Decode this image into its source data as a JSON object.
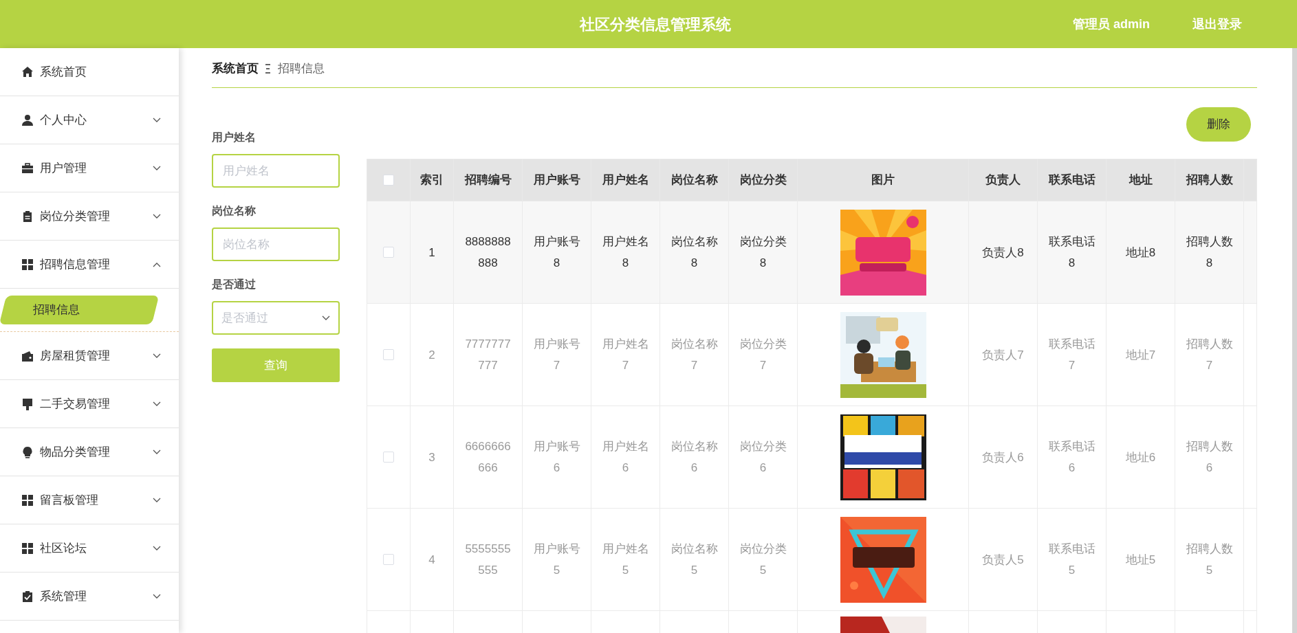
{
  "header": {
    "title": "社区分类信息管理系统",
    "user": "管理员 admin",
    "logout": "退出登录"
  },
  "sidebar": {
    "items": [
      {
        "label": "系统首页",
        "kind": "link"
      },
      {
        "label": "个人中心",
        "kind": "menu",
        "expanded": false
      },
      {
        "label": "用户管理",
        "kind": "menu",
        "expanded": false
      },
      {
        "label": "岗位分类管理",
        "kind": "menu",
        "expanded": false
      },
      {
        "label": "招聘信息管理",
        "kind": "menu",
        "expanded": true,
        "children": [
          {
            "label": "招聘信息",
            "selected": true
          }
        ]
      },
      {
        "label": "房屋租赁管理",
        "kind": "menu",
        "expanded": false
      },
      {
        "label": "二手交易管理",
        "kind": "menu",
        "expanded": false
      },
      {
        "label": "物品分类管理",
        "kind": "menu",
        "expanded": false
      },
      {
        "label": "留言板管理",
        "kind": "menu",
        "expanded": false
      },
      {
        "label": "社区论坛",
        "kind": "menu",
        "expanded": false
      },
      {
        "label": "系统管理",
        "kind": "menu",
        "expanded": false
      }
    ]
  },
  "breadcrumb": {
    "home": "系统首页",
    "current": "招聘信息"
  },
  "filters": [
    {
      "label": "用户姓名",
      "kind": "text",
      "placeholder": "用户姓名"
    },
    {
      "label": "岗位名称",
      "kind": "text",
      "placeholder": "岗位名称"
    },
    {
      "label": "是否通过",
      "kind": "select",
      "placeholder": "是否通过"
    }
  ],
  "search_button": "查询",
  "delete_button": "删除",
  "table": {
    "select_all": {
      "checked": false
    },
    "columns": [
      {
        "label": "索引",
        "kind": "text"
      },
      {
        "label": "招聘编号",
        "kind": "text"
      },
      {
        "label": "用户账号",
        "kind": "text"
      },
      {
        "label": "用户姓名",
        "kind": "text"
      },
      {
        "label": "岗位名称",
        "kind": "text"
      },
      {
        "label": "岗位分类",
        "kind": "text"
      },
      {
        "label": "图片",
        "kind": "picture"
      },
      {
        "label": "负责人",
        "kind": "text"
      },
      {
        "label": "联系电话",
        "kind": "text"
      },
      {
        "label": "地址",
        "kind": "text"
      },
      {
        "label": "招聘人数",
        "kind": "text"
      }
    ],
    "rows": [
      {
        "checked": false,
        "hovered": true,
        "cells": [
          "1",
          "8888888888",
          "用户账号8",
          "用户姓名8",
          "岗位名称8",
          "岗位分类8",
          "",
          "负责人8",
          "联系电话8",
          "地址8",
          "招聘人数8"
        ]
      },
      {
        "checked": false,
        "hovered": false,
        "cells": [
          "2",
          "7777777777",
          "用户账号7",
          "用户姓名7",
          "岗位名称7",
          "岗位分类7",
          "",
          "负责人7",
          "联系电话7",
          "地址7",
          "招聘人数7"
        ]
      },
      {
        "checked": false,
        "hovered": false,
        "cells": [
          "3",
          "6666666666",
          "用户账号6",
          "用户姓名6",
          "岗位名称6",
          "岗位分类6",
          "",
          "负责人6",
          "联系电话6",
          "地址6",
          "招聘人数6"
        ]
      },
      {
        "checked": false,
        "hovered": false,
        "cells": [
          "4",
          "5555555555",
          "用户账号5",
          "用户姓名5",
          "岗位名称5",
          "岗位分类5",
          "",
          "负责人5",
          "联系电话5",
          "地址5",
          "招聘人数5"
        ]
      }
    ]
  }
}
